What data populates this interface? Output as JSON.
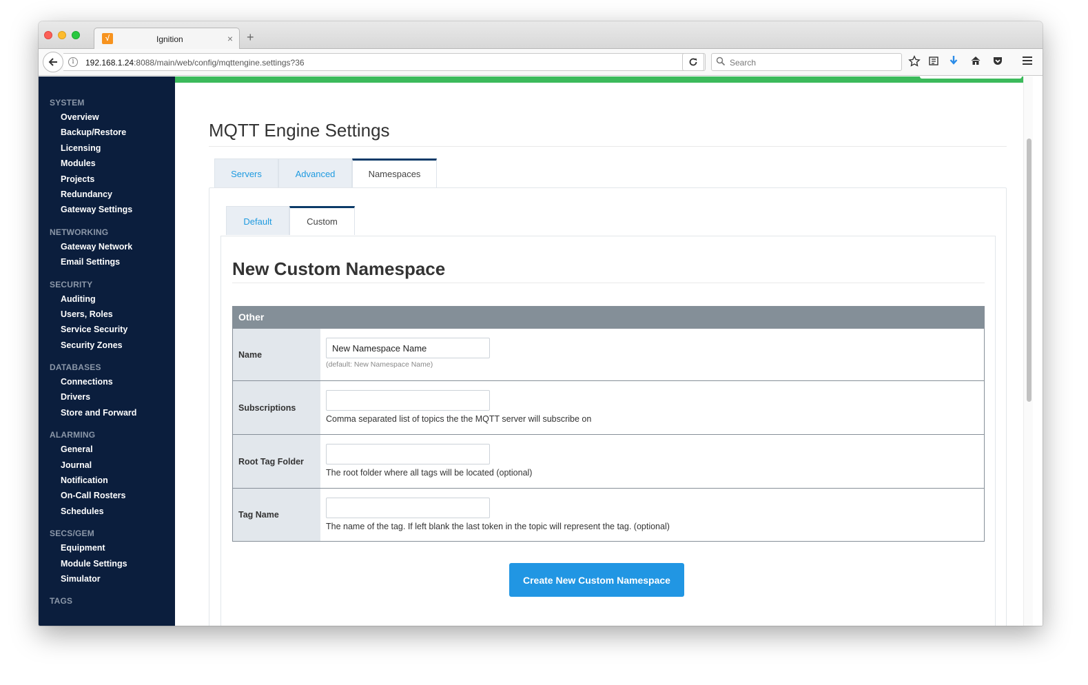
{
  "browser": {
    "tab_title": "Ignition",
    "favicon_glyph": "√",
    "close_glyph": "×",
    "new_tab_glyph": "+",
    "url_host": "192.168.1.24",
    "url_rest": ":8088/main/web/config/mqttengine.settings?36",
    "search_placeholder": "Search",
    "icons": [
      "back-arrow-icon",
      "info-icon",
      "reload-icon",
      "search-icon",
      "bookmark-star-icon",
      "reading-list-icon",
      "download-icon",
      "home-icon",
      "pocket-icon",
      "menu-icon"
    ],
    "download_color": "#2a8ce8"
  },
  "sidebar": {
    "sections": [
      {
        "title": "SYSTEM",
        "items": [
          "Overview",
          "Backup/Restore",
          "Licensing",
          "Modules",
          "Projects",
          "Redundancy",
          "Gateway Settings"
        ]
      },
      {
        "title": "NETWORKING",
        "items": [
          "Gateway Network",
          "Email Settings"
        ]
      },
      {
        "title": "SECURITY",
        "items": [
          "Auditing",
          "Users, Roles",
          "Service Security",
          "Security Zones"
        ]
      },
      {
        "title": "DATABASES",
        "items": [
          "Connections",
          "Drivers",
          "Store and Forward"
        ]
      },
      {
        "title": "ALARMING",
        "items": [
          "General",
          "Journal",
          "Notification",
          "On-Call Rosters",
          "Schedules"
        ]
      },
      {
        "title": "SECS/GEM",
        "items": [
          "Equipment",
          "Module Settings",
          "Simulator"
        ]
      },
      {
        "title": "TAGS",
        "items": []
      }
    ]
  },
  "page": {
    "title": "MQTT Engine Settings",
    "tabs": [
      {
        "label": "Servers",
        "active": false
      },
      {
        "label": "Advanced",
        "active": false
      },
      {
        "label": "Namespaces",
        "active": true
      }
    ],
    "subtabs": [
      {
        "label": "Default",
        "active": false
      },
      {
        "label": "Custom",
        "active": true
      }
    ],
    "section_title": "New Custom Namespace",
    "form": {
      "group": "Other",
      "rows": [
        {
          "label": "Name",
          "value": "New Namespace Name",
          "hint": "(default: New Namespace Name)",
          "hint_style": "small"
        },
        {
          "label": "Subscriptions",
          "value": "",
          "hint": "Comma separated list of topics the the MQTT server will subscribe on",
          "hint_style": "normal"
        },
        {
          "label": "Root Tag Folder",
          "value": "",
          "hint": "The root folder where all tags will be located (optional)",
          "hint_style": "normal"
        },
        {
          "label": "Tag Name",
          "value": "",
          "hint": "The name of the tag. If left blank the last token in the topic will represent the tag. (optional)",
          "hint_style": "normal"
        }
      ]
    },
    "submit_label": "Create New Custom Namespace"
  },
  "colors": {
    "sidebar_bg": "#0b1e3d",
    "status_bar": "#3cba5b",
    "link": "#1e9ae0",
    "button": "#2196e3",
    "table_header": "#848f98"
  }
}
